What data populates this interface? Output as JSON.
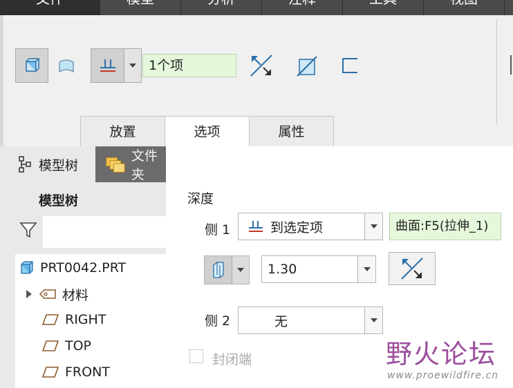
{
  "menu": {
    "items": [
      "文件",
      "模型",
      "分析",
      "注释",
      "工具",
      "视图"
    ]
  },
  "ribbon": {
    "reference_value": "1个项"
  },
  "tabs": [
    {
      "label": "放置"
    },
    {
      "label": "选项"
    },
    {
      "label": "属性"
    }
  ],
  "left_panel": {
    "tab_model_tree": "模型树",
    "tab_files": "文件夹",
    "title": "模型树",
    "tree": [
      {
        "label": "PRT0042.PRT",
        "icon": "part-icon"
      },
      {
        "label": "材料",
        "icon": "material-icon"
      },
      {
        "label": "RIGHT",
        "icon": "datum-plane-icon"
      },
      {
        "label": "TOP",
        "icon": "datum-plane-icon"
      },
      {
        "label": "FRONT",
        "icon": "datum-plane-icon"
      }
    ]
  },
  "options": {
    "depth_label": "深度",
    "side1_label": "侧 1",
    "side1_value": "到选定项",
    "side1_reference": "曲面:F5(拉伸_1)",
    "offset_value": "1.30",
    "side2_label": "侧 2",
    "side2_value": "无",
    "capped_ends_label": "封闭端"
  },
  "watermark": {
    "text": "野火论坛",
    "url": "www.proewildfire.cn"
  },
  "colors": {
    "menubar": "#4a4a4a",
    "green_field": "#e6f8dc",
    "watermark": "#9c4f9c"
  }
}
